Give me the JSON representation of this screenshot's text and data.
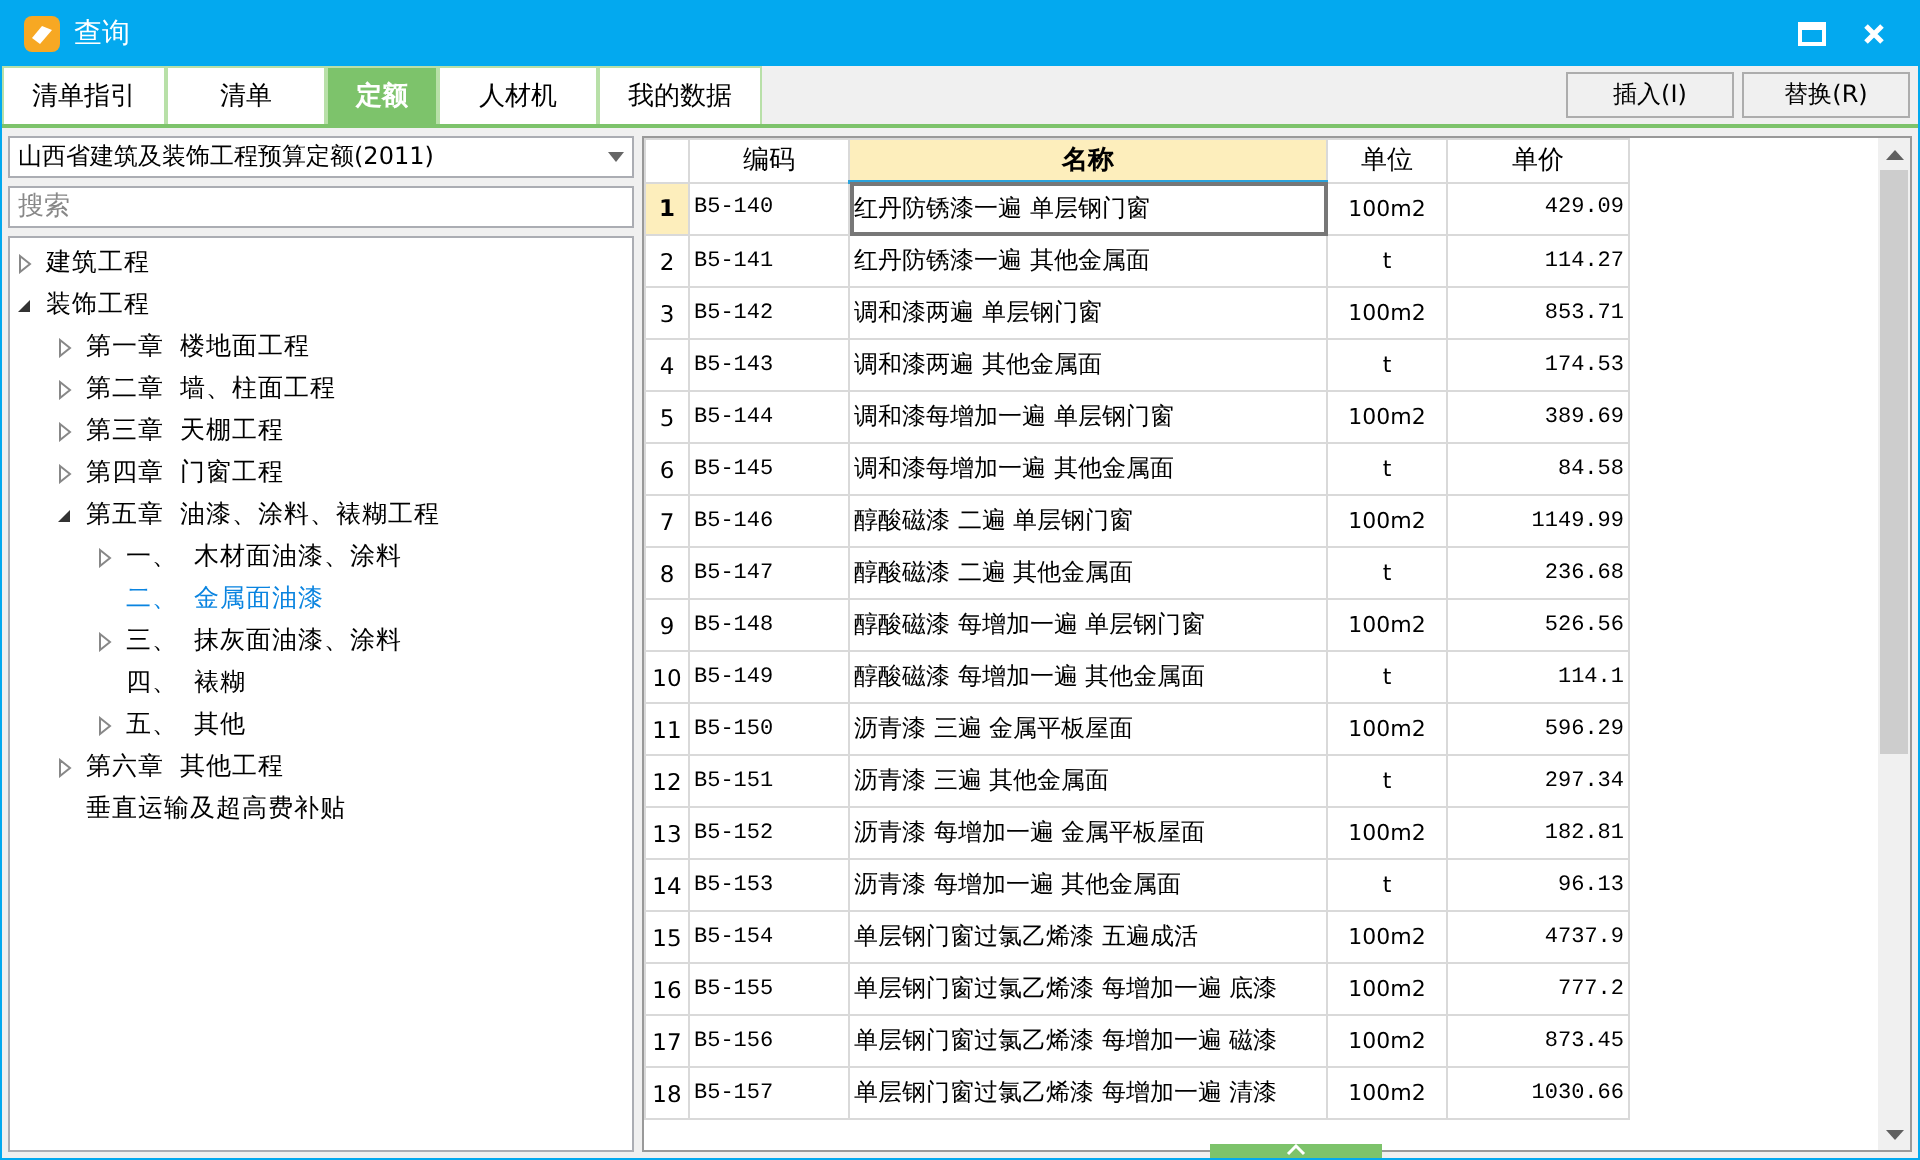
{
  "window": {
    "title": "查询"
  },
  "tabs": [
    {
      "label": "清单指引",
      "selected": false
    },
    {
      "label": "清单",
      "selected": false
    },
    {
      "label": "定额",
      "selected": true
    },
    {
      "label": "人材机",
      "selected": false
    },
    {
      "label": "我的数据",
      "selected": false
    }
  ],
  "buttons": [
    "插入(I)",
    "替换(R)"
  ],
  "library_select": {
    "value": "山西省建筑及装饰工程预算定额(2011)"
  },
  "search": {
    "placeholder": "搜索"
  },
  "tree": [
    {
      "label": "建筑工程",
      "kind": "collapsed",
      "selected": false
    },
    {
      "label": "装饰工程",
      "kind": "expanded",
      "selected": false,
      "children": [
        {
          "label": "第一章  楼地面工程",
          "kind": "collapsed",
          "selected": false
        },
        {
          "label": "第二章  墙、柱面工程",
          "kind": "collapsed",
          "selected": false
        },
        {
          "label": "第三章  天棚工程",
          "kind": "collapsed",
          "selected": false
        },
        {
          "label": "第四章  门窗工程",
          "kind": "collapsed",
          "selected": false
        },
        {
          "label": "第五章  油漆、涂料、裱糊工程",
          "kind": "expanded",
          "selected": false,
          "children": [
            {
              "label": "一、  木材面油漆、涂料",
              "kind": "collapsed",
              "selected": false
            },
            {
              "label": "二、  金属面油漆",
              "kind": "leaf",
              "selected": true
            },
            {
              "label": "三、  抹灰面油漆、涂料",
              "kind": "collapsed",
              "selected": false
            },
            {
              "label": "四、  裱糊",
              "kind": "leaf",
              "selected": false
            },
            {
              "label": "五、  其他",
              "kind": "collapsed",
              "selected": false
            }
          ]
        },
        {
          "label": "第六章  其他工程",
          "kind": "collapsed",
          "selected": false
        },
        {
          "label": "垂直运输及超高费补贴",
          "kind": "leaf",
          "selected": false
        }
      ]
    }
  ],
  "table": {
    "columns": [
      {
        "label": "编码",
        "selected": false
      },
      {
        "label": "名称",
        "selected": true
      },
      {
        "label": "单位",
        "selected": false
      },
      {
        "label": "单价",
        "selected": false
      }
    ],
    "rows": [
      {
        "index": "1",
        "code": "B5-140",
        "name": "红丹防锈漆一遍 单层钢门窗",
        "unit": "100m2",
        "price": "429.09",
        "selected": true
      },
      {
        "index": "2",
        "code": "B5-141",
        "name": "红丹防锈漆一遍 其他金属面",
        "unit": "t",
        "price": "114.27",
        "selected": false
      },
      {
        "index": "3",
        "code": "B5-142",
        "name": "调和漆两遍 单层钢门窗",
        "unit": "100m2",
        "price": "853.71",
        "selected": false
      },
      {
        "index": "4",
        "code": "B5-143",
        "name": "调和漆两遍 其他金属面",
        "unit": "t",
        "price": "174.53",
        "selected": false
      },
      {
        "index": "5",
        "code": "B5-144",
        "name": "调和漆每增加一遍 单层钢门窗",
        "unit": "100m2",
        "price": "389.69",
        "selected": false
      },
      {
        "index": "6",
        "code": "B5-145",
        "name": "调和漆每增加一遍 其他金属面",
        "unit": "t",
        "price": "84.58",
        "selected": false
      },
      {
        "index": "7",
        "code": "B5-146",
        "name": "醇酸磁漆 二遍 单层钢门窗",
        "unit": "100m2",
        "price": "1149.99",
        "selected": false
      },
      {
        "index": "8",
        "code": "B5-147",
        "name": "醇酸磁漆 二遍 其他金属面",
        "unit": "t",
        "price": "236.68",
        "selected": false
      },
      {
        "index": "9",
        "code": "B5-148",
        "name": "醇酸磁漆 每增加一遍 单层钢门窗",
        "unit": "100m2",
        "price": "526.56",
        "selected": false
      },
      {
        "index": "10",
        "code": "B5-149",
        "name": "醇酸磁漆 每增加一遍 其他金属面",
        "unit": "t",
        "price": "114.1",
        "selected": false
      },
      {
        "index": "11",
        "code": "B5-150",
        "name": "沥青漆 三遍 金属平板屋面",
        "unit": "100m2",
        "price": "596.29",
        "selected": false
      },
      {
        "index": "12",
        "code": "B5-151",
        "name": "沥青漆 三遍 其他金属面",
        "unit": "t",
        "price": "297.34",
        "selected": false
      },
      {
        "index": "13",
        "code": "B5-152",
        "name": "沥青漆 每增加一遍 金属平板屋面",
        "unit": "100m2",
        "price": "182.81",
        "selected": false
      },
      {
        "index": "14",
        "code": "B5-153",
        "name": "沥青漆 每增加一遍 其他金属面",
        "unit": "t",
        "price": "96.13",
        "selected": false
      },
      {
        "index": "15",
        "code": "B5-154",
        "name": "单层钢门窗过氯乙烯漆 五遍成活",
        "unit": "100m2",
        "price": "4737.9",
        "selected": false
      },
      {
        "index": "16",
        "code": "B5-155",
        "name": "单层钢门窗过氯乙烯漆 每增加一遍 底漆",
        "unit": "100m2",
        "price": "777.2",
        "selected": false
      },
      {
        "index": "17",
        "code": "B5-156",
        "name": "单层钢门窗过氯乙烯漆 每增加一遍 磁漆",
        "unit": "100m2",
        "price": "873.45",
        "selected": false
      },
      {
        "index": "18",
        "code": "B5-157",
        "name": "单层钢门窗过氯乙烯漆 每增加一遍 清漆",
        "unit": "100m2",
        "price": "1030.66",
        "selected": false
      }
    ]
  }
}
